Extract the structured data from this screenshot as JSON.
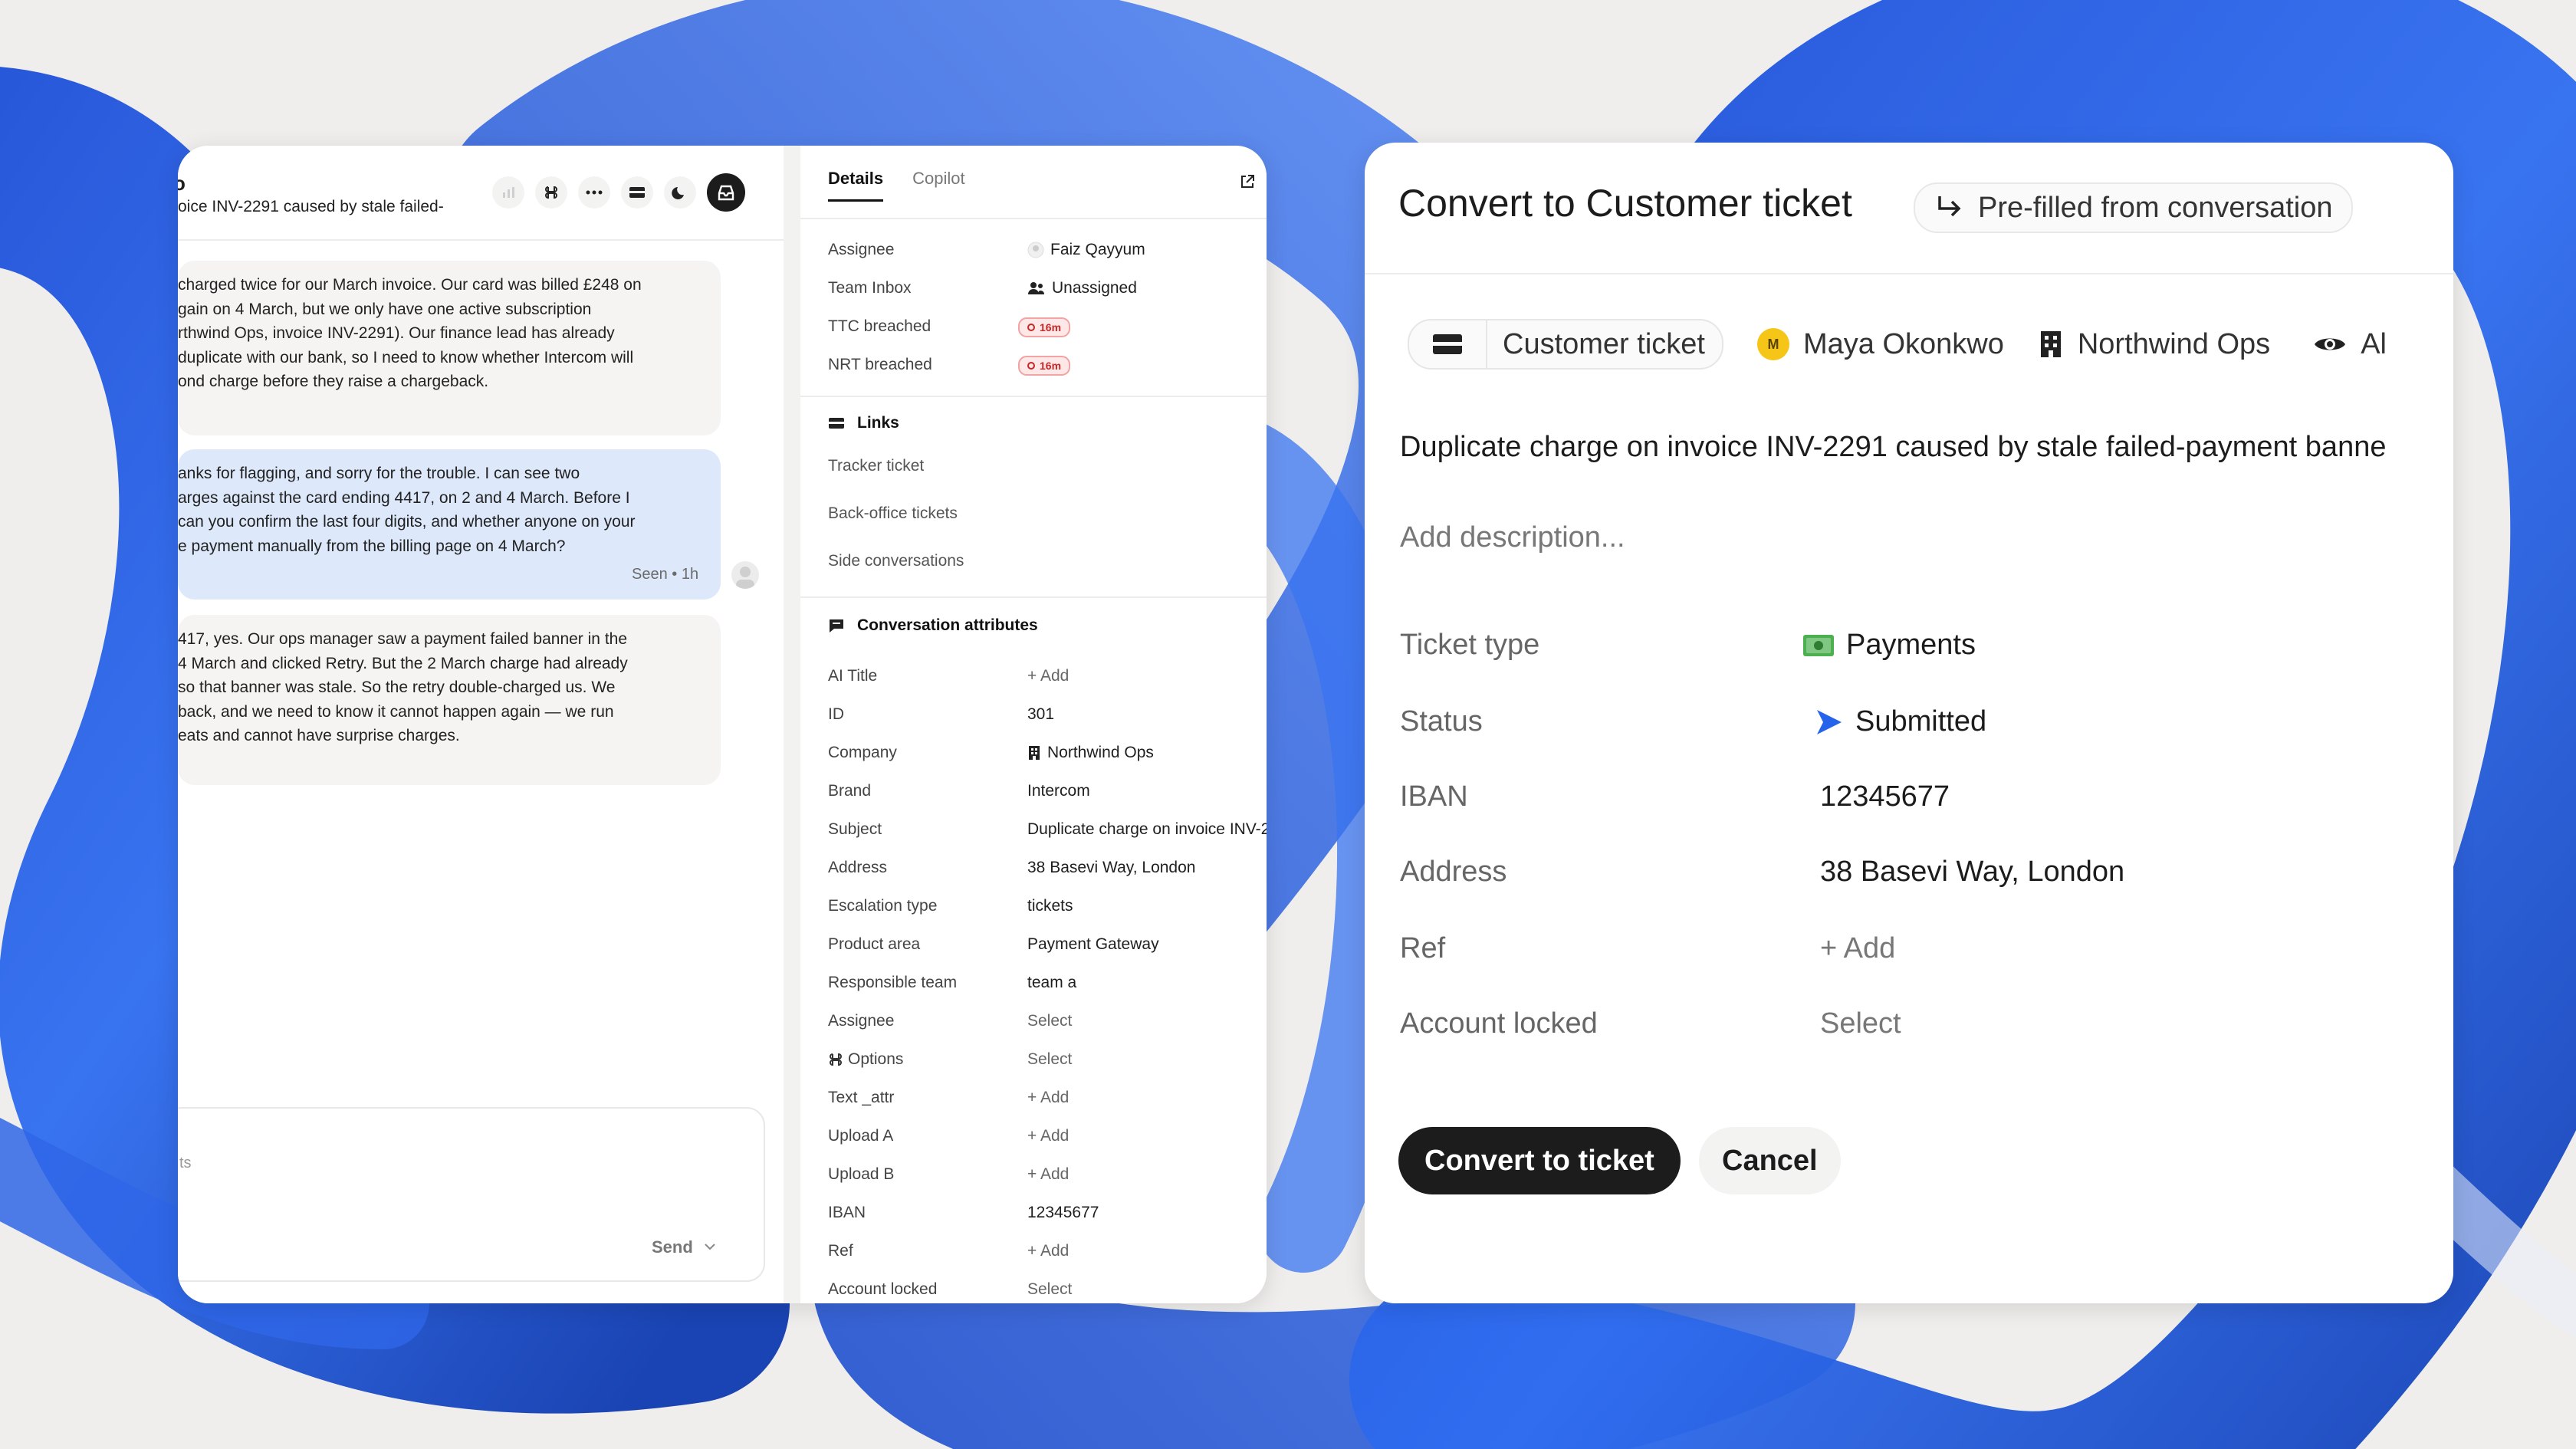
{
  "conversation": {
    "title": "o",
    "subtitle": "oice INV-2291 caused by stale failed-",
    "messages": [
      {
        "text": "charged twice for our March invoice. Our card was billed £248 on\ngain on 4 March, but we only have one active subscription\nrthwind Ops, invoice INV-2291). Our finance lead has already\n duplicate with our bank, so I need to know whether Intercom will\nond charge before they raise a chargeback."
      },
      {
        "text": "anks for flagging, and sorry for the trouble. I can see two\narges against the card ending 4417, on 2 and 4 March. Before I\n can you confirm the last four digits, and whether anyone on your\ne payment manually from the billing page on 4 March?"
      },
      {
        "text": "417, yes. Our ops manager saw a payment failed banner in the\n4 March and clicked Retry. But the 2 March charge had already\n so that banner was stale. So the retry double-charged us. We\n back, and we need to know it cannot happen again — we run\neats and cannot have surprise charges."
      }
    ],
    "seen_label": "Seen • 1h",
    "composer": {
      "placeholder": "ts",
      "send_label": "Send"
    }
  },
  "details": {
    "tabs": [
      {
        "label": "Details"
      },
      {
        "label": "Copilot"
      }
    ],
    "fields": [
      {
        "key": "Assignee",
        "value": "Faiz Qayyum"
      },
      {
        "key": "Team Inbox",
        "value": "Unassigned"
      },
      {
        "key": "TTC breached",
        "value": "16m"
      },
      {
        "key": "NRT breached",
        "value": "16m"
      }
    ],
    "links_heading": "Links",
    "links": [
      "Tracker ticket",
      "Back-office tickets",
      "Side conversations"
    ],
    "attributes_heading": "Conversation attributes",
    "attributes": [
      {
        "key": "AI Title",
        "value": "+ Add"
      },
      {
        "key": "ID",
        "value": "301"
      },
      {
        "key": "Company",
        "value": "Northwind Ops"
      },
      {
        "key": "Brand",
        "value": "Intercom"
      },
      {
        "key": "Subject",
        "value": "Duplicate charge on invoice INV-2"
      },
      {
        "key": "Address",
        "value": "38 Basevi Way, London"
      },
      {
        "key": "Escalation type",
        "value": "tickets"
      },
      {
        "key": "Product area",
        "value": "Payment Gateway"
      },
      {
        "key": "Responsible team",
        "value": "team a"
      },
      {
        "key": "Assignee",
        "value": "Select"
      },
      {
        "key": "Options",
        "value": "Select"
      },
      {
        "key": "Text _attr",
        "value": "+ Add"
      },
      {
        "key": "Upload A",
        "value": "+ Add"
      },
      {
        "key": "Upload B",
        "value": "+ Add"
      },
      {
        "key": "IBAN",
        "value": "12345677"
      },
      {
        "key": "Ref",
        "value": "+ Add"
      },
      {
        "key": "Account locked",
        "value": "Select"
      }
    ]
  },
  "modal": {
    "title": "Convert to Customer ticket",
    "prefill_label": "Pre-filled from conversation",
    "ticket_chip": "Customer ticket",
    "assignee_chip": "Maya Okonkwo",
    "avatar_initial": "M",
    "company_chip": "Northwind Ops",
    "visibility_chip": "Al",
    "subject": "Duplicate charge on invoice INV-2291 caused by stale failed-payment banne",
    "description_placeholder": "Add description...",
    "fields": [
      {
        "key": "Ticket type",
        "value": "Payments",
        "icon": "money-icon"
      },
      {
        "key": "Status",
        "value": "Submitted",
        "icon": "submitted-icon"
      },
      {
        "key": "IBAN",
        "value": "12345677"
      },
      {
        "key": "Address",
        "value": "38 Basevi Way, London"
      },
      {
        "key": "Ref",
        "value": "+ Add"
      },
      {
        "key": "Account locked",
        "value": "Select"
      }
    ],
    "convert_label": "Convert to ticket",
    "cancel_label": "Cancel",
    "colors": {
      "accent_blue": "#2563eb",
      "dark_button": "#1c1c1c",
      "breach_red": "#c62828"
    }
  }
}
